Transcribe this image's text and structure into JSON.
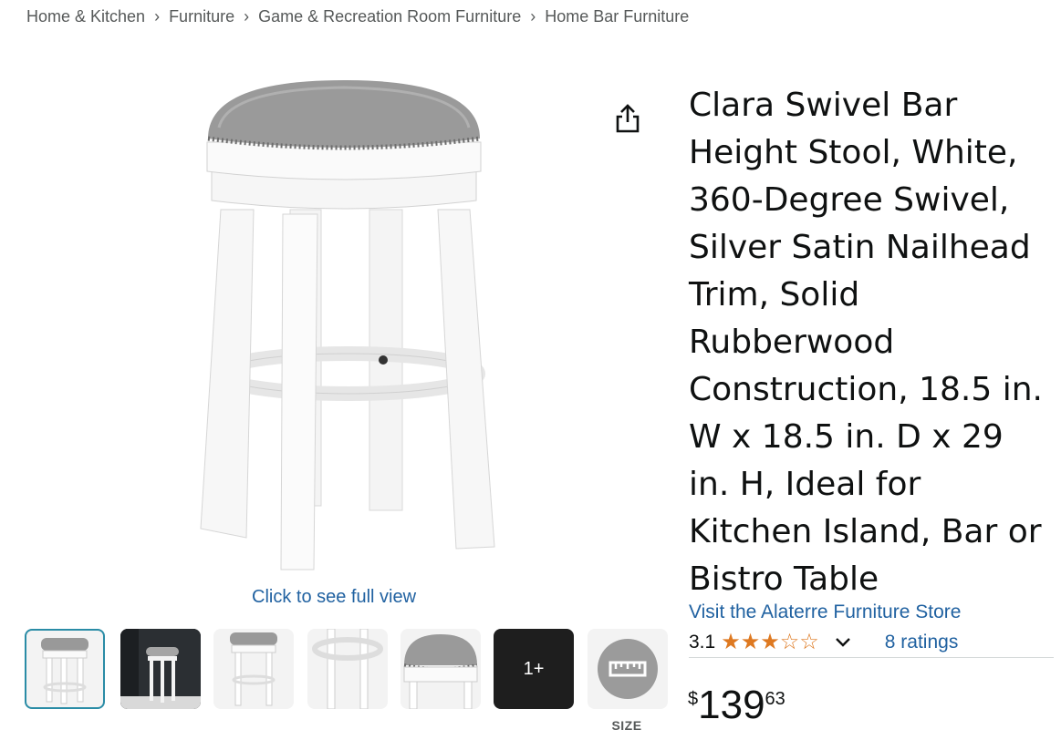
{
  "breadcrumb": {
    "items": [
      "Home & Kitchen",
      "Furniture",
      "Game & Recreation Room Furniture",
      "Home Bar Furniture"
    ],
    "separator": "›"
  },
  "gallery": {
    "zoom_label": "Click to see full view",
    "more_label": "1+",
    "size_label": "SIZE"
  },
  "product": {
    "title": "Clara Swivel Bar Height Stool, White, 360-Degree Swivel, Silver Satin Nailhead Trim, Solid Rubberwood Construction, 18.5 in. W x 18.5 in. D x 29 in. H, Ideal for Kitchen Island, Bar or Bistro Table",
    "store_link": "Visit the Alaterre Furniture Store",
    "rating": "3.1",
    "stars": 3.1,
    "ratings_count": "8 ratings",
    "price": {
      "symbol": "$",
      "whole": "139",
      "fraction": "63"
    }
  },
  "colors": {
    "link": "#2162a1",
    "star": "#de7921",
    "selected_border": "#2a8ca6"
  },
  "icons": [
    "share-icon",
    "chevron-down-icon",
    "ruler-icon",
    "star-icon"
  ]
}
